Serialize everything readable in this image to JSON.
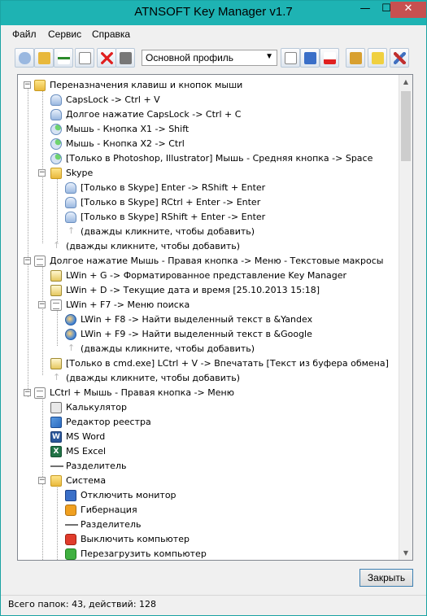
{
  "window": {
    "title": "ATNSOFT Key Manager v1.7",
    "min": "—",
    "max": "☐",
    "close": "✕"
  },
  "menu": [
    "Файл",
    "Сервис",
    "Справка"
  ],
  "toolbar": {
    "profile": "Основной профиль"
  },
  "tree": [
    {
      "label": "Переназначения клавиш и кнопок мыши",
      "icon": "folder-icon"
    },
    {
      "label": "CapsLock -> Ctrl + V",
      "icon": "keyboard-icon"
    },
    {
      "label": "Долгое нажатие CapsLock -> Ctrl + C",
      "icon": "keyboard-icon"
    },
    {
      "label": "Мышь - Кнопка X1 -> Shift",
      "icon": "mouse-icon"
    },
    {
      "label": "Мышь - Кнопка X2 -> Ctrl",
      "icon": "mouse-icon"
    },
    {
      "label": "[Только в Photoshop, Illustrator] Мышь - Средняя кнопка -> Space",
      "icon": "mouse-icon"
    },
    {
      "label": "Skype",
      "icon": "folder-icon"
    },
    {
      "label": "[Только в Skype] Enter -> RShift + Enter",
      "icon": "keyboard-icon"
    },
    {
      "label": "[Только в Skype] RCtrl + Enter -> Enter",
      "icon": "keyboard-icon"
    },
    {
      "label": "[Только в Skype] RShift + Enter -> Enter",
      "icon": "keyboard-icon"
    },
    {
      "label": "(дважды кликните, чтобы добавить)",
      "icon": "add-arrow-icon"
    },
    {
      "label": "(дважды кликните, чтобы добавить)",
      "icon": "add-arrow-icon"
    },
    {
      "label": "Долгое нажатие Мышь - Правая кнопка -> Меню - Текстовые макросы",
      "icon": "document-icon"
    },
    {
      "label": "LWin + G -> Форматированное представление Key Manager",
      "icon": "macro-icon"
    },
    {
      "label": "LWin + D -> Текущие дата и время [25.10.2013 15:18]",
      "icon": "macro-icon"
    },
    {
      "label": "LWin + F7 -> Меню поиска",
      "icon": "document-icon"
    },
    {
      "label": "LWin + F8 -> Найти выделенный текст в &Yandex",
      "icon": "globe-icon"
    },
    {
      "label": "LWin + F9 -> Найти выделенный текст в &Google",
      "icon": "globe-icon"
    },
    {
      "label": "(дважды кликните, чтобы добавить)",
      "icon": "add-arrow-icon"
    },
    {
      "label": "[Только в cmd.exe] LCtrl + V -> Впечатать [Текст из буфера обмена]",
      "icon": "macro-icon"
    },
    {
      "label": "(дважды кликните, чтобы добавить)",
      "icon": "add-arrow-icon"
    },
    {
      "label": "LCtrl + Мышь - Правая кнопка -> Меню",
      "icon": "document-icon"
    },
    {
      "label": "Калькулятор",
      "icon": "calculator-icon"
    },
    {
      "label": "Редактор реестра",
      "icon": "registry-icon"
    },
    {
      "label": "MS Word",
      "icon": "word-icon"
    },
    {
      "label": "MS Excel",
      "icon": "excel-icon"
    },
    {
      "label": "Разделитель",
      "icon": "separator-icon"
    },
    {
      "label": "Система",
      "icon": "folder-icon"
    },
    {
      "label": "Отключить монитор",
      "icon": "monitor-icon"
    },
    {
      "label": "Гибернация",
      "icon": "hibernate-icon"
    },
    {
      "label": "Разделитель",
      "icon": "separator-icon"
    },
    {
      "label": "Выключить компьютер",
      "icon": "power-off-icon"
    },
    {
      "label": "Перезагрузить компьютер",
      "icon": "reboot-icon"
    }
  ],
  "icon_glyphs": {
    "word": "W",
    "excel": "X"
  },
  "buttons": {
    "close": "Закрыть"
  },
  "status": {
    "text": "Всего папок: 43, действий: 128"
  }
}
